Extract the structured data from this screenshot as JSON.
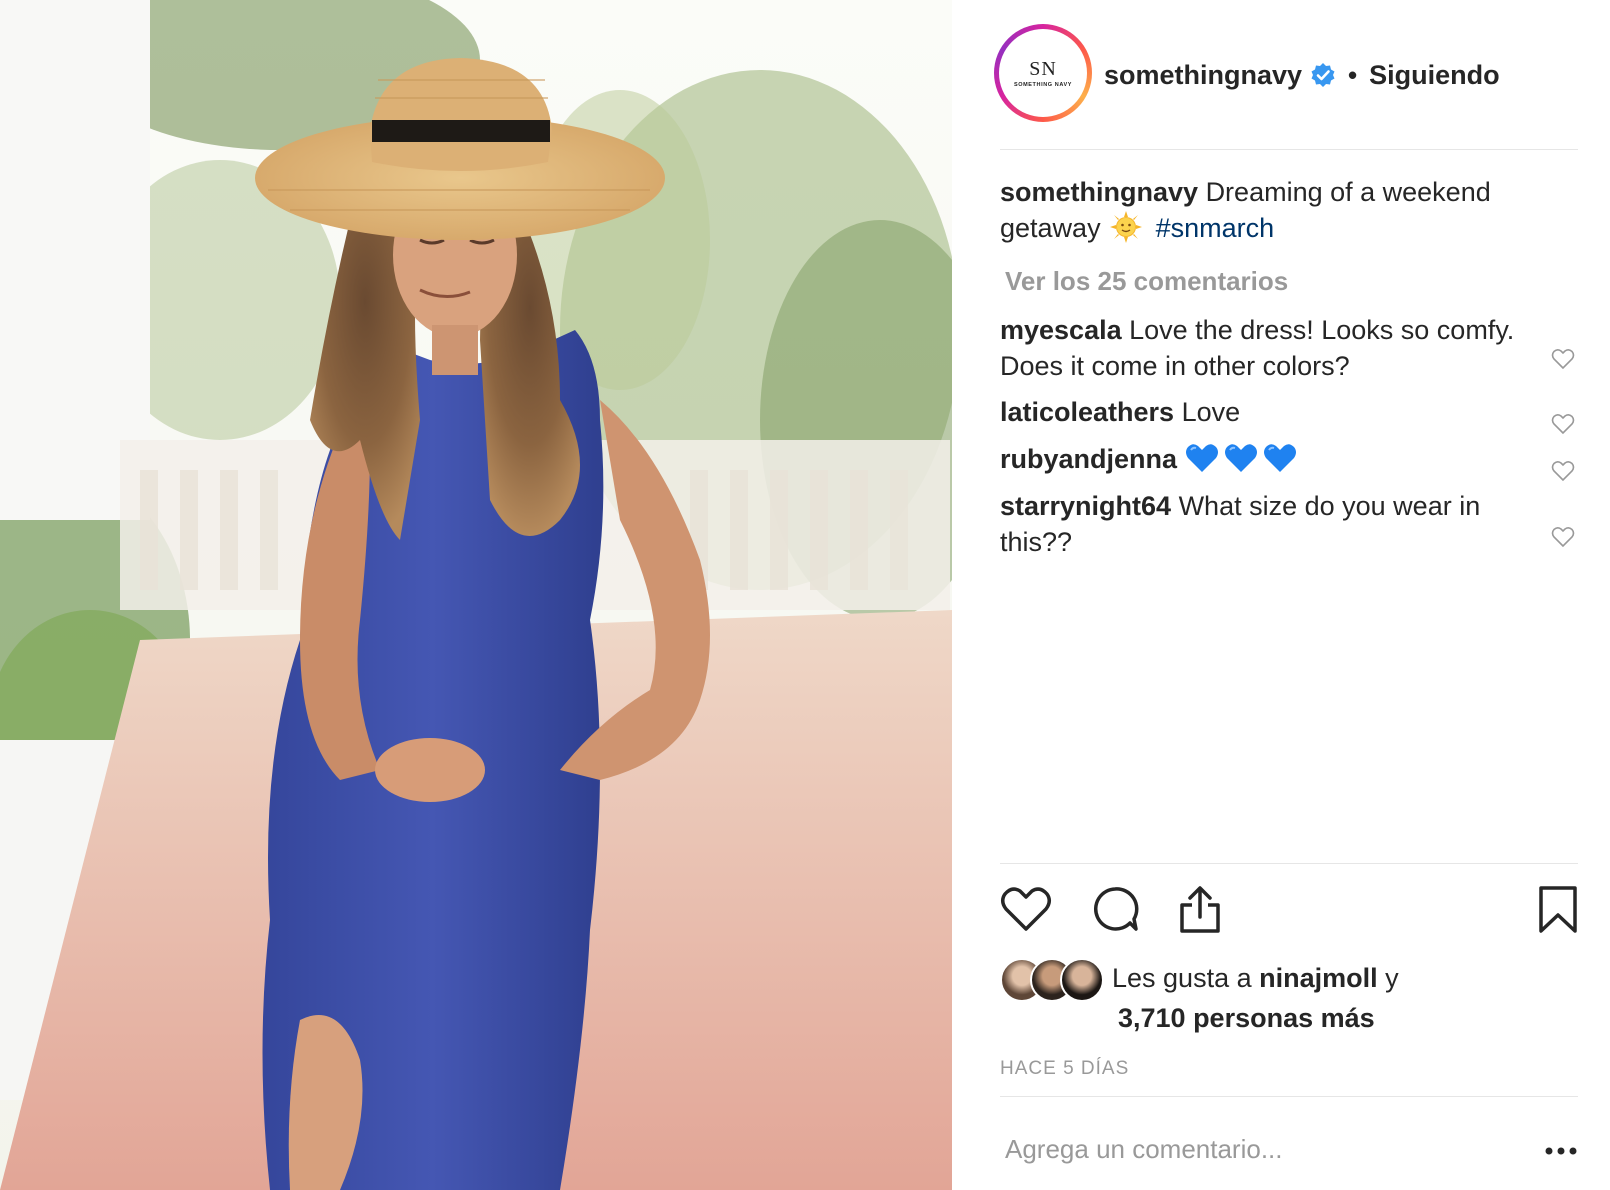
{
  "post": {
    "account": "somethingnavy",
    "avatar": {
      "monogram": "SN",
      "subtitle": "SOMETHING NAVY"
    },
    "verified_icon": "verified-badge-icon",
    "separator": "•",
    "follow_status": "Siguiendo",
    "caption": {
      "user": "somethingnavy",
      "text": "Dreaming of a weekend getaway",
      "emoji": "sun-with-face-emoji",
      "hashtag": "#snmarch"
    },
    "view_all_comments": "Ver los 25 comentarios",
    "comments": [
      {
        "user": "myescala",
        "text": "Love the dress! Looks so comfy. Does it come in other colors?"
      },
      {
        "user": "laticoleathers",
        "text": "Love"
      },
      {
        "user": "rubyandjenna",
        "text": "",
        "emoji": [
          "blue-heart",
          "blue-heart",
          "blue-heart"
        ]
      },
      {
        "user": "starrynight64",
        "text": "What size do you wear in this??"
      }
    ],
    "actions": [
      "like-icon",
      "comment-icon",
      "share-icon",
      "save-icon"
    ],
    "likes": {
      "prefix": "Les gusta a",
      "first_liker": "ninajmoll",
      "conjunction": "y",
      "others": "3,710 personas más"
    },
    "timestamp": "HACE 5 DÍAS",
    "add_comment_placeholder": "Agrega un comentario...",
    "more_icon": "more-options-icon"
  },
  "colors": {
    "text": "#262626",
    "muted": "#999999",
    "hashtag": "#003569",
    "verified": "#3897f0",
    "divider": "#e6e6e6",
    "dress": "#3f4fa6"
  }
}
